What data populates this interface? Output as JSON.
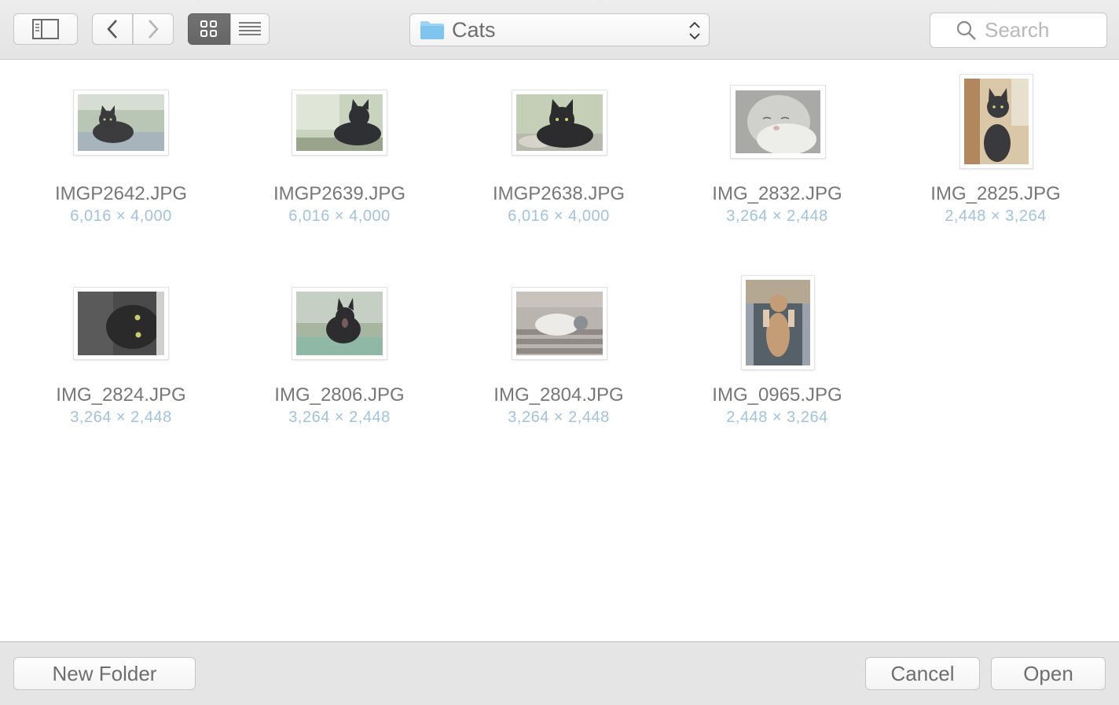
{
  "toolbar": {
    "location_label": "Cats",
    "search_placeholder": "Search",
    "icon_colors": {
      "folder": "#8ccaf2",
      "selected_view_bg": "#6a6a6a"
    }
  },
  "files": [
    {
      "name": "IMGP2642.JPG",
      "dimensions": "6,016 × 4,000",
      "orientation": "landscape"
    },
    {
      "name": "IMGP2639.JPG",
      "dimensions": "6,016 × 4,000",
      "orientation": "landscape"
    },
    {
      "name": "IMGP2638.JPG",
      "dimensions": "6,016 × 4,000",
      "orientation": "landscape"
    },
    {
      "name": "IMG_2832.JPG",
      "dimensions": "3,264 × 2,448",
      "orientation": "landscape"
    },
    {
      "name": "IMG_2825.JPG",
      "dimensions": "2,448 × 3,264",
      "orientation": "portrait"
    },
    {
      "name": "IMG_2824.JPG",
      "dimensions": "3,264 × 2,448",
      "orientation": "landscape"
    },
    {
      "name": "IMG_2806.JPG",
      "dimensions": "3,264 × 2,448",
      "orientation": "landscape"
    },
    {
      "name": "IMG_2804.JPG",
      "dimensions": "3,264 × 2,448",
      "orientation": "landscape"
    },
    {
      "name": "IMG_0965.JPG",
      "dimensions": "2,448 × 3,264",
      "orientation": "portrait"
    }
  ],
  "footer": {
    "new_folder_label": "New Folder",
    "cancel_label": "Cancel",
    "open_label": "Open"
  }
}
